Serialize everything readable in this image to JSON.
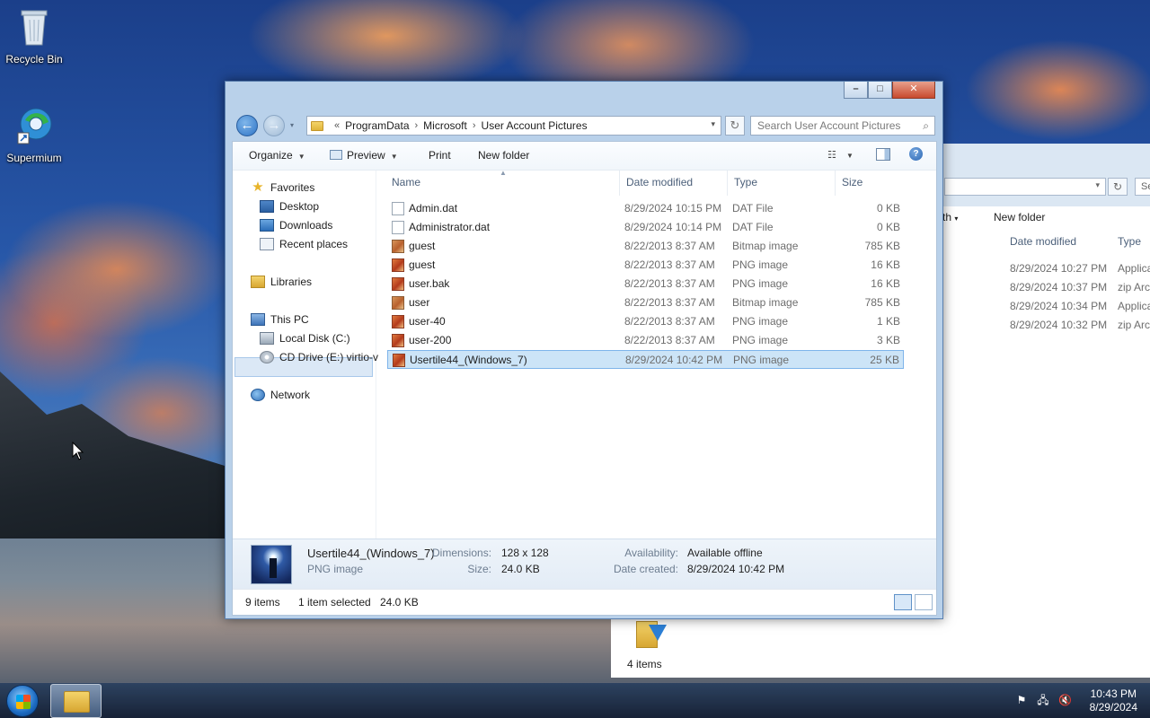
{
  "desktop": {
    "icons": [
      {
        "label": "Recycle Bin",
        "icon": "recycle-bin-icon"
      },
      {
        "label": "Supermium",
        "icon": "supermium-icon"
      }
    ]
  },
  "background_window": {
    "toolbar_partial": "th",
    "new_folder": "New folder",
    "search_partial": "Se",
    "headers": {
      "date_modified": "Date modified",
      "type": "Type"
    },
    "rows": [
      {
        "date": "8/29/2024 10:27 PM",
        "type": "Applica"
      },
      {
        "date": "8/29/2024 10:37 PM",
        "type": "zip Arc"
      },
      {
        "date": "8/29/2024 10:34 PM",
        "type": "Applica"
      },
      {
        "date": "8/29/2024 10:32 PM",
        "type": "zip Arc"
      }
    ],
    "status": "4 items"
  },
  "window": {
    "controls": {
      "minimize": "–",
      "maximize": "□",
      "close": "✕"
    },
    "address": {
      "prefix": "«",
      "crumbs": [
        "ProgramData",
        "Microsoft",
        "User Account Pictures"
      ],
      "separator": "›"
    },
    "search_placeholder": "Search User Account Pictures",
    "commands": {
      "organize": "Organize",
      "preview": "Preview",
      "print": "Print",
      "new_folder": "New folder"
    },
    "nav": {
      "favorites": "Favorites",
      "desktop": "Desktop",
      "downloads": "Downloads",
      "recent_places": "Recent places",
      "libraries": "Libraries",
      "this_pc": "This PC",
      "local_disk": "Local Disk (C:)",
      "cd_drive": "CD Drive (E:) virtio-v",
      "network": "Network"
    },
    "columns": {
      "name": "Name",
      "date": "Date modified",
      "type": "Type",
      "size": "Size"
    },
    "files": [
      {
        "name": "Admin.dat",
        "date": "8/29/2024 10:15 PM",
        "type": "DAT File",
        "size": "0 KB",
        "icon": "doc"
      },
      {
        "name": "Administrator.dat",
        "date": "8/29/2024 10:14 PM",
        "type": "DAT File",
        "size": "0 KB",
        "icon": "doc"
      },
      {
        "name": "guest",
        "date": "8/22/2013 8:37 AM",
        "type": "Bitmap image",
        "size": "785 KB",
        "icon": "bmp"
      },
      {
        "name": "guest",
        "date": "8/22/2013 8:37 AM",
        "type": "PNG image",
        "size": "16 KB",
        "icon": "png"
      },
      {
        "name": "user.bak",
        "date": "8/22/2013 8:37 AM",
        "type": "PNG image",
        "size": "16 KB",
        "icon": "png"
      },
      {
        "name": "user",
        "date": "8/22/2013 8:37 AM",
        "type": "Bitmap image",
        "size": "785 KB",
        "icon": "bmp"
      },
      {
        "name": "user-40",
        "date": "8/22/2013 8:37 AM",
        "type": "PNG image",
        "size": "1 KB",
        "icon": "png"
      },
      {
        "name": "user-200",
        "date": "8/22/2013 8:37 AM",
        "type": "PNG image",
        "size": "3 KB",
        "icon": "png"
      },
      {
        "name": "Usertile44_(Windows_7)",
        "date": "8/29/2024 10:42 PM",
        "type": "PNG image",
        "size": "25 KB",
        "icon": "png",
        "selected": true
      }
    ],
    "details": {
      "filename": "Usertile44_(Windows_7)",
      "filetype": "PNG image",
      "dimensions_label": "Dimensions:",
      "dimensions": "128 x 128",
      "size_label": "Size:",
      "size": "24.0 KB",
      "availability_label": "Availability:",
      "availability": "Available offline",
      "created_label": "Date created:",
      "created": "8/29/2024 10:42 PM"
    },
    "status": {
      "items": "9 items",
      "selected": "1 item selected",
      "selected_size": "24.0 KB"
    }
  },
  "taskbar": {
    "time": "10:43 PM",
    "date": "8/29/2024"
  }
}
